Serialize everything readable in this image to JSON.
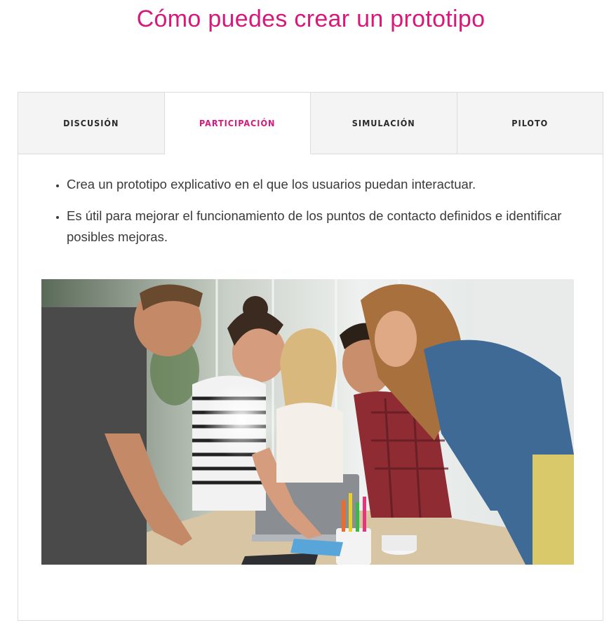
{
  "page": {
    "title": "Cómo puedes crear un prototipo"
  },
  "tabs": [
    {
      "label": "DISCUSIÓN",
      "active": false
    },
    {
      "label": "PARTICIPACIÓN",
      "active": true
    },
    {
      "label": "SIMULACIÓN",
      "active": false
    },
    {
      "label": "PILOTO",
      "active": false
    }
  ],
  "panel": {
    "bullets": [
      "Crea un prototipo explicativo en el que los usuarios puedan interactuar.",
      "Es útil para mejorar el funcionamiento de los puntos de contacto definidos e identificar posibles mejoras."
    ],
    "image": {
      "subject": "team-collaboration-photo"
    }
  },
  "colors": {
    "accent": "#d6197b",
    "tab_inactive_bg": "#f4f4f4",
    "border": "#dcdcdc"
  }
}
